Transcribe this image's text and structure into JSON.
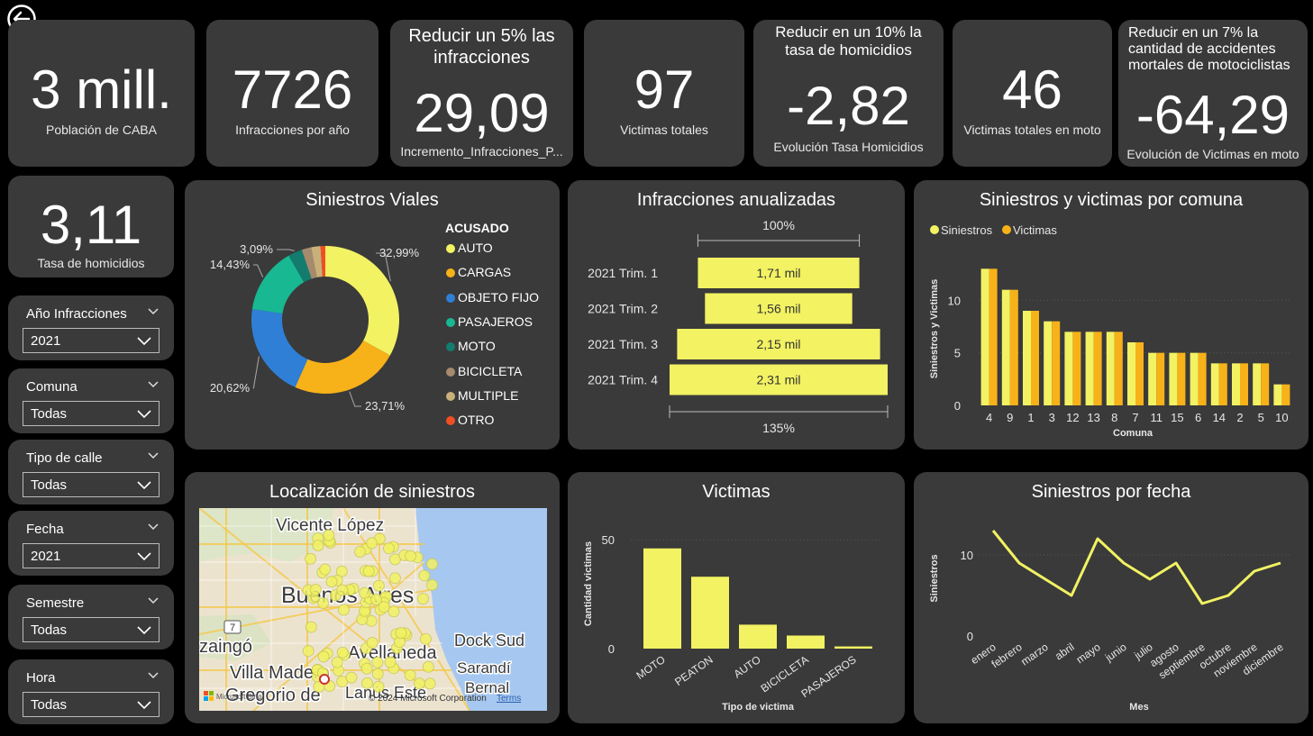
{
  "kpis": {
    "poblacion": {
      "value": "3 mill.",
      "label": "Población de CABA"
    },
    "infracciones": {
      "value": "7726",
      "label": "Infracciones por año"
    },
    "reducir_infr": {
      "head": "Reducir un 5% las infracciones",
      "value": "29,09",
      "label": "Incremento_Infracciones_P..."
    },
    "victimas": {
      "value": "97",
      "label": "Victimas totales"
    },
    "reducir_hom": {
      "head": "Reducir en un 10% la tasa de homicidios",
      "value": "-2,82",
      "label": "Evolución Tasa Homicidios"
    },
    "victimas_moto": {
      "value": "46",
      "label": "Victimas totales en moto"
    },
    "reducir_moto": {
      "head": "Reducir en un 7% la cantidad de accidentes mortales de motociclistas",
      "value": "-64,29",
      "label": "Evolución de Victimas en moto"
    },
    "tasa": {
      "value": "3,11",
      "label": "Tasa de homicidios"
    }
  },
  "slicers": [
    {
      "title": "Año Infracciones",
      "value": "2021"
    },
    {
      "title": "Comuna",
      "value": "Todas"
    },
    {
      "title": "Tipo de calle",
      "value": "Todas"
    },
    {
      "title": "Fecha",
      "value": "2021"
    },
    {
      "title": "Semestre",
      "value": "Todas"
    },
    {
      "title": "Hora",
      "value": "Todas"
    }
  ],
  "colors": {
    "accent": "#f2f263",
    "orange": "#f7b219",
    "card": "#3a3a3a"
  },
  "map": {
    "title": "Localización de siniestros",
    "labels": [
      "Vicente López",
      "Buenos Aires",
      "Dock Sud",
      "Avellaneda",
      "Villa Madero",
      "Sarandí",
      "zaingó",
      "Gregorio de",
      "Lanús Este",
      "Bernal"
    ],
    "copyright": "© 2024 Microsoft Corporation",
    "terms": "Terms",
    "bing": "Microsoft Bing",
    "road_badge": "7"
  },
  "chart_data": [
    {
      "type": "pie",
      "title": "Siniestros Viales",
      "legend_title": "ACUSADO",
      "categories": [
        "AUTO",
        "CARGAS",
        "OBJETO FIJO",
        "PASAJEROS",
        "MOTO",
        "BICICLETA",
        "MULTIPLE",
        "OTRO"
      ],
      "values": [
        32.99,
        23.71,
        20.62,
        14.43,
        3.09,
        2.06,
        2.06,
        1.04
      ],
      "data_labels": [
        "32,99%",
        "23,71%",
        "20,62%",
        "14,43%",
        "3,09%"
      ],
      "colors": [
        "#f2f263",
        "#f7b219",
        "#2f7fd6",
        "#18b892",
        "#137c6e",
        "#a68a6e",
        "#c9b07a",
        "#f04e23"
      ]
    },
    {
      "type": "bar",
      "title": "Infracciones anualizadas",
      "categories": [
        "2021 Trim. 1",
        "2021 Trim. 2",
        "2021 Trim. 3",
        "2021 Trim. 4"
      ],
      "values": [
        1710,
        1560,
        2150,
        2310
      ],
      "data_labels": [
        "1,71 mil",
        "1,56 mil",
        "2,15 mil",
        "2,31 mil"
      ],
      "top_label": "100%",
      "bottom_label": "135%"
    },
    {
      "type": "bar",
      "title": "Siniestros y victimas por comuna",
      "xlabel": "Comuna",
      "ylabel": "Siniestros y Victimas",
      "categories": [
        "4",
        "9",
        "1",
        "3",
        "12",
        "13",
        "8",
        "7",
        "11",
        "15",
        "6",
        "14",
        "2",
        "5",
        "10"
      ],
      "series": [
        {
          "name": "Siniestros",
          "color": "#f2f263",
          "values": [
            13,
            11,
            9,
            8,
            7,
            7,
            7,
            6,
            5,
            5,
            5,
            4,
            4,
            4,
            2
          ]
        },
        {
          "name": "Victimas",
          "color": "#f7b219",
          "values": [
            13,
            11,
            9,
            8,
            7,
            7,
            7,
            6,
            5,
            5,
            5,
            4,
            4,
            4,
            2
          ]
        }
      ],
      "yticks": [
        0,
        5,
        10
      ],
      "ylim": [
        0,
        15
      ]
    },
    {
      "type": "bar",
      "title": "Victimas",
      "xlabel": "Tipo de victima",
      "ylabel": "Cantidad victimas",
      "categories": [
        "MOTO",
        "PEATON",
        "AUTO",
        "BICICLETA",
        "PASAJEROS"
      ],
      "values": [
        46,
        33,
        11,
        6,
        1
      ],
      "yticks": [
        0,
        50
      ],
      "ylim": [
        0,
        55
      ]
    },
    {
      "type": "line",
      "title": "Siniestros por fecha",
      "xlabel": "Mes",
      "ylabel": "Siniestros",
      "categories": [
        "enero",
        "febrero",
        "marzo",
        "abril",
        "mayo",
        "junio",
        "julio",
        "agosto",
        "septiembre",
        "octubre",
        "noviembre",
        "diciembre"
      ],
      "values": [
        13,
        9,
        7,
        5,
        12,
        9,
        7,
        9,
        4,
        5,
        8,
        9
      ],
      "yticks": [
        0,
        10
      ],
      "ylim": [
        0,
        15
      ]
    }
  ]
}
